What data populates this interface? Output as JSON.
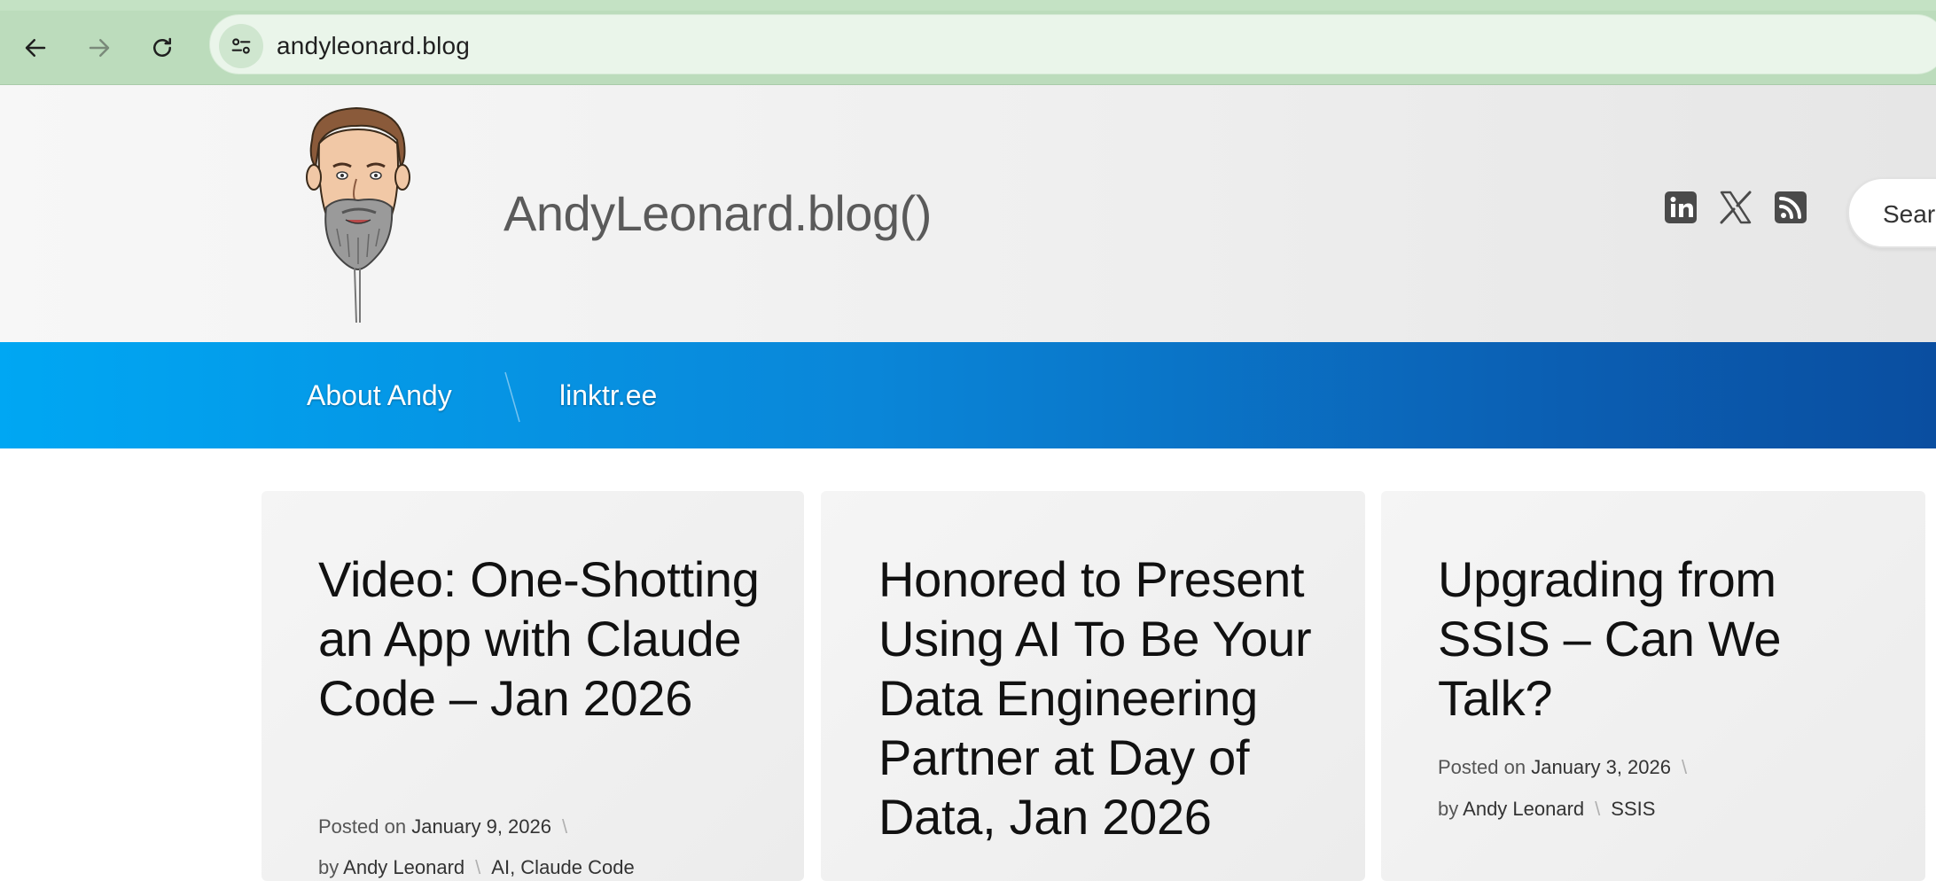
{
  "browser": {
    "url": "andyleonard.blog",
    "icons": [
      "back-arrow-icon",
      "forward-arrow-icon",
      "reload-icon",
      "site-info-icon"
    ]
  },
  "site": {
    "title": "AndyLeonard.blog()",
    "social_icons": [
      "linkedin-icon",
      "x-twitter-icon",
      "rss-icon"
    ],
    "search_label": "Search"
  },
  "nav": {
    "items": [
      {
        "label": "About Andy"
      },
      {
        "label": "linktr.ee"
      }
    ]
  },
  "posts": [
    {
      "title": "Video: One-Shotting an App with Claude Code – Jan 2026",
      "posted_prefix": "Posted on",
      "date": "January 9, 2026",
      "by_prefix": "by",
      "author": "Andy Leonard",
      "categories": "AI, Claude Code"
    },
    {
      "title": "Honored to Present Using AI To Be Your Data Engineering Partner at Day of Data, Jan 2026"
    },
    {
      "title": "Upgrading from SSIS – Can We Talk?",
      "posted_prefix": "Posted on",
      "date": "January 3, 2026",
      "by_prefix": "by",
      "author": "Andy Leonard",
      "categories": "SSIS"
    }
  ]
}
